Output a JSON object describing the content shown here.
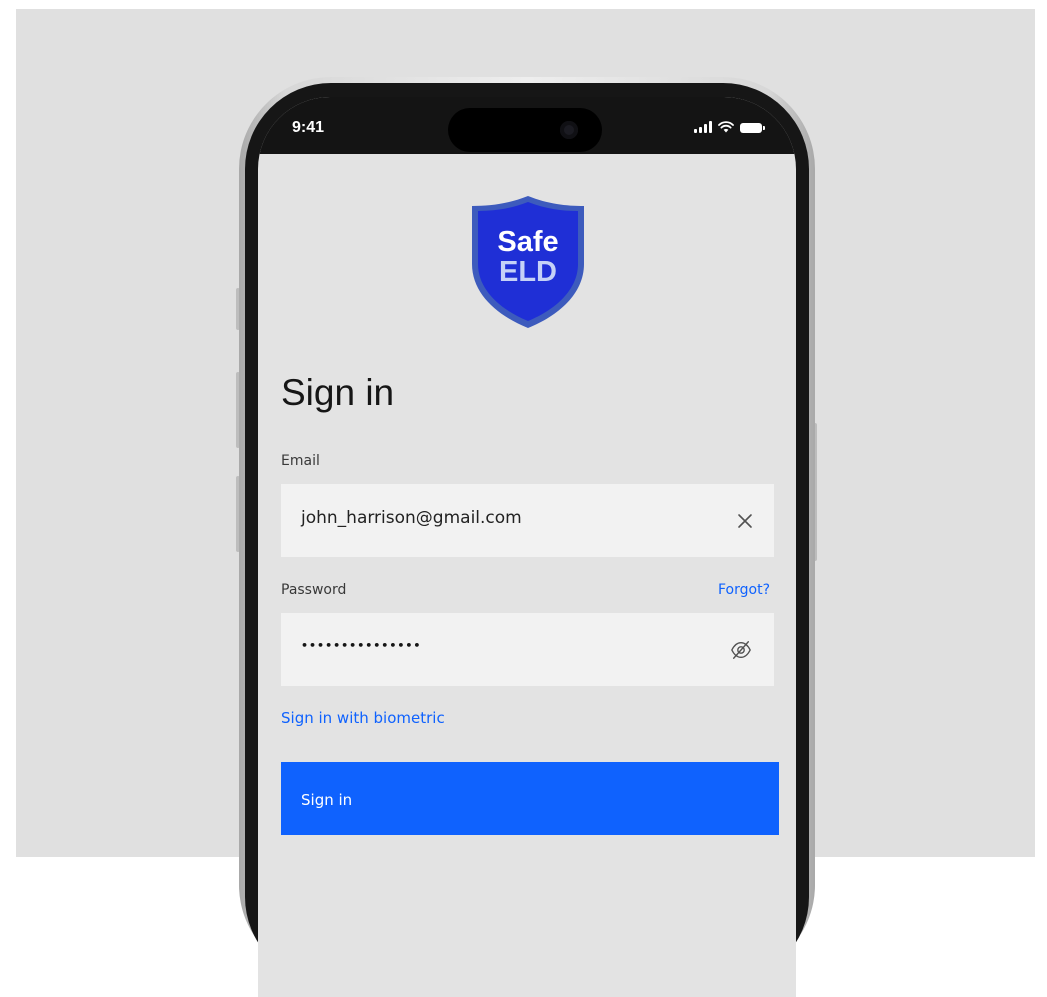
{
  "status_bar": {
    "time": "9:41",
    "icons": [
      "signal-icon",
      "wifi-icon",
      "battery-icon"
    ]
  },
  "logo": {
    "line1": "Safe",
    "line2": "ELD",
    "colors": {
      "shield": "#1f2fd6",
      "border": "#3d5bbd",
      "text": "#ffffff",
      "accent": "#c5d1f7"
    }
  },
  "page": {
    "title": "Sign in"
  },
  "email": {
    "label": "Email",
    "value": "john_harrison@gmail.com",
    "clear_icon": "close-icon"
  },
  "password": {
    "label": "Password",
    "forgot_link": "Forgot?",
    "value_masked": "•••••••••••••••",
    "toggle_icon": "eye-off-icon"
  },
  "biometric_link": "Sign in with biometric",
  "submit": {
    "label": "Sign in"
  },
  "colors": {
    "primary": "#0f62fe",
    "background": "#e0e0e0",
    "field": "#f2f2f2",
    "text": "#161616"
  }
}
